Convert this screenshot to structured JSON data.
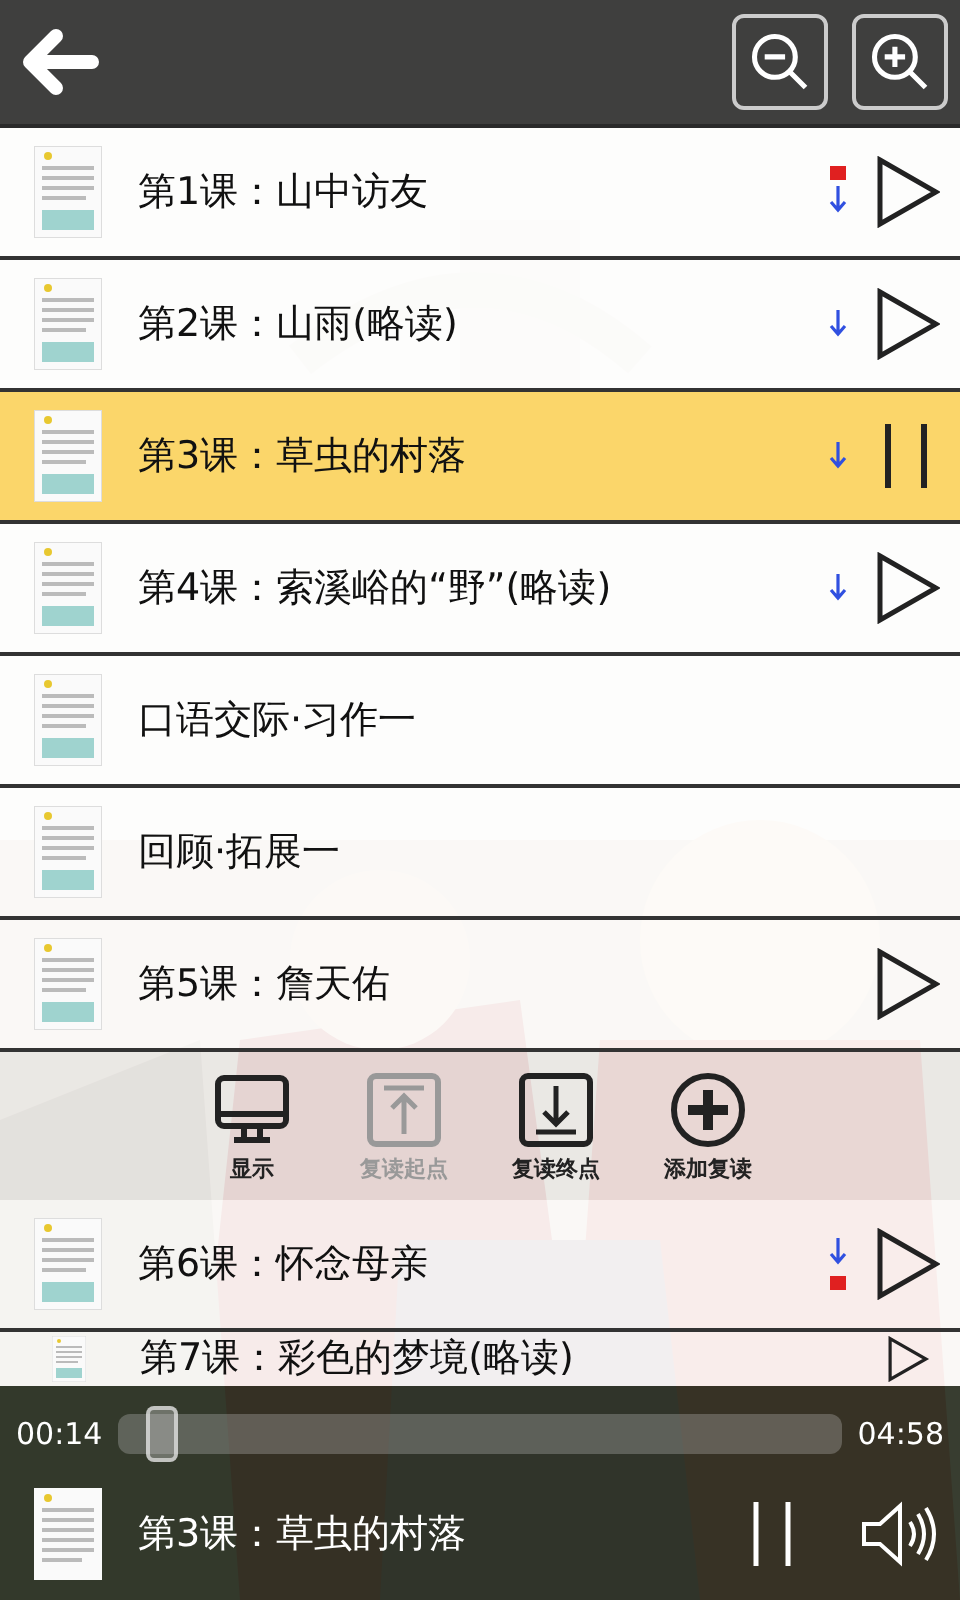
{
  "lessons": [
    {
      "title": "第1课：山中访友",
      "downloaded": true,
      "flag_above": true,
      "flag_below": false,
      "has_audio": true,
      "playing": false
    },
    {
      "title": "第2课：山雨(略读)",
      "downloaded": true,
      "flag_above": false,
      "flag_below": false,
      "has_audio": true,
      "playing": false
    },
    {
      "title": "第3课：草虫的村落",
      "downloaded": true,
      "flag_above": false,
      "flag_below": false,
      "has_audio": true,
      "playing": true
    },
    {
      "title": "第4课：索溪峪的“野”(略读)",
      "downloaded": true,
      "flag_above": false,
      "flag_below": false,
      "has_audio": true,
      "playing": false
    },
    {
      "title": "口语交际·习作一",
      "downloaded": false,
      "flag_above": false,
      "flag_below": false,
      "has_audio": false,
      "playing": false
    },
    {
      "title": "回顾·拓展一",
      "downloaded": false,
      "flag_above": false,
      "flag_below": false,
      "has_audio": false,
      "playing": false
    },
    {
      "title": "第5课：詹天佑",
      "downloaded": false,
      "flag_above": false,
      "flag_below": false,
      "has_audio": true,
      "playing": false
    }
  ],
  "toolbar": [
    {
      "kind": "display",
      "label": "显示",
      "disabled": false
    },
    {
      "kind": "start",
      "label": "复读起点",
      "disabled": true
    },
    {
      "kind": "end",
      "label": "复读终点",
      "disabled": false
    },
    {
      "kind": "add",
      "label": "添加复读",
      "disabled": false
    }
  ],
  "lessons_after": [
    {
      "title": "第6课：怀念母亲",
      "downloaded": true,
      "flag_above": false,
      "flag_below": true,
      "has_audio": true,
      "playing": false
    },
    {
      "title": "第7课：彩色的梦境(略读)",
      "downloaded": false,
      "flag_above": false,
      "flag_below": false,
      "has_audio": true,
      "playing": false
    }
  ],
  "player": {
    "elapsed": "00:14",
    "total": "04:58",
    "level": 0.06,
    "title": "第3课：草虫的村落",
    "playing": true
  }
}
